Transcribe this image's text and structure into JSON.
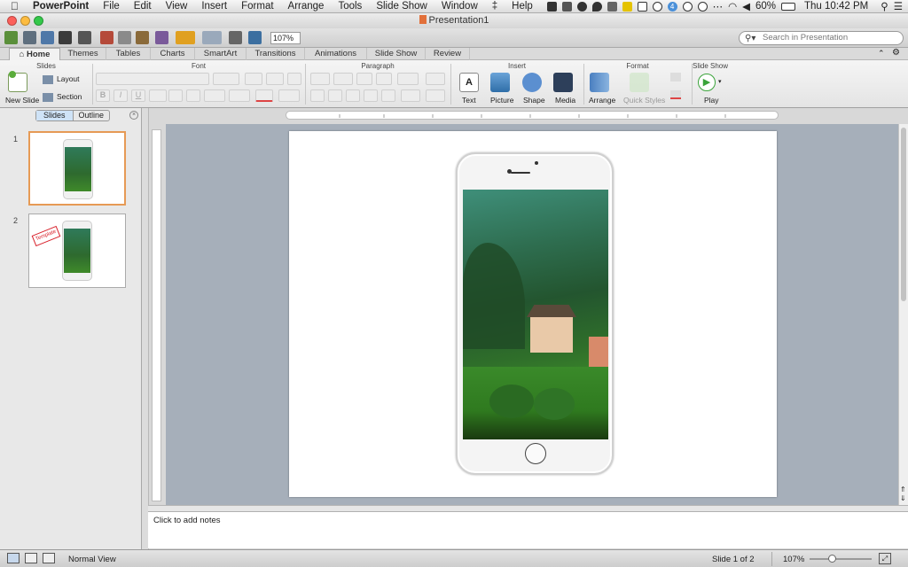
{
  "menubar": {
    "app_name": "PowerPoint",
    "items": [
      "File",
      "Edit",
      "View",
      "Insert",
      "Format",
      "Arrange",
      "Tools",
      "Slide Show",
      "Window",
      "Help"
    ],
    "battery": "60%",
    "clock": "Thu 10:42 PM",
    "notif_badge": "4"
  },
  "window": {
    "title": "Presentation1"
  },
  "toolbar": {
    "zoom_value": "107%",
    "search_placeholder": "Search in Presentation"
  },
  "ribbon_tabs": [
    "Home",
    "Themes",
    "Tables",
    "Charts",
    "SmartArt",
    "Transitions",
    "Animations",
    "Slide Show",
    "Review"
  ],
  "ribbon": {
    "groups": {
      "slides": "Slides",
      "font": "Font",
      "paragraph": "Paragraph",
      "insert": "Insert",
      "format": "Format",
      "slideshow": "Slide Show"
    },
    "buttons": {
      "new_slide": "New Slide",
      "layout": "Layout",
      "section": "Section",
      "text": "Text",
      "picture": "Picture",
      "shape": "Shape",
      "media": "Media",
      "arrange": "Arrange",
      "quick_styles": "Quick Styles",
      "play": "Play"
    }
  },
  "left_pane": {
    "tabs": [
      "Slides",
      "Outline"
    ],
    "slides": [
      {
        "number": "1"
      },
      {
        "number": "2",
        "stamp": "Template"
      }
    ]
  },
  "notes": {
    "placeholder": "Click to add notes"
  },
  "statusbar": {
    "view_mode": "Normal View",
    "slide_indicator": "Slide 1 of 2",
    "zoom": "107%",
    "zoom_level": 0.35
  },
  "colors": {
    "accent_selection": "#e69a55",
    "canvas_bg": "#a6afba",
    "play_green": "#3aa33a"
  }
}
